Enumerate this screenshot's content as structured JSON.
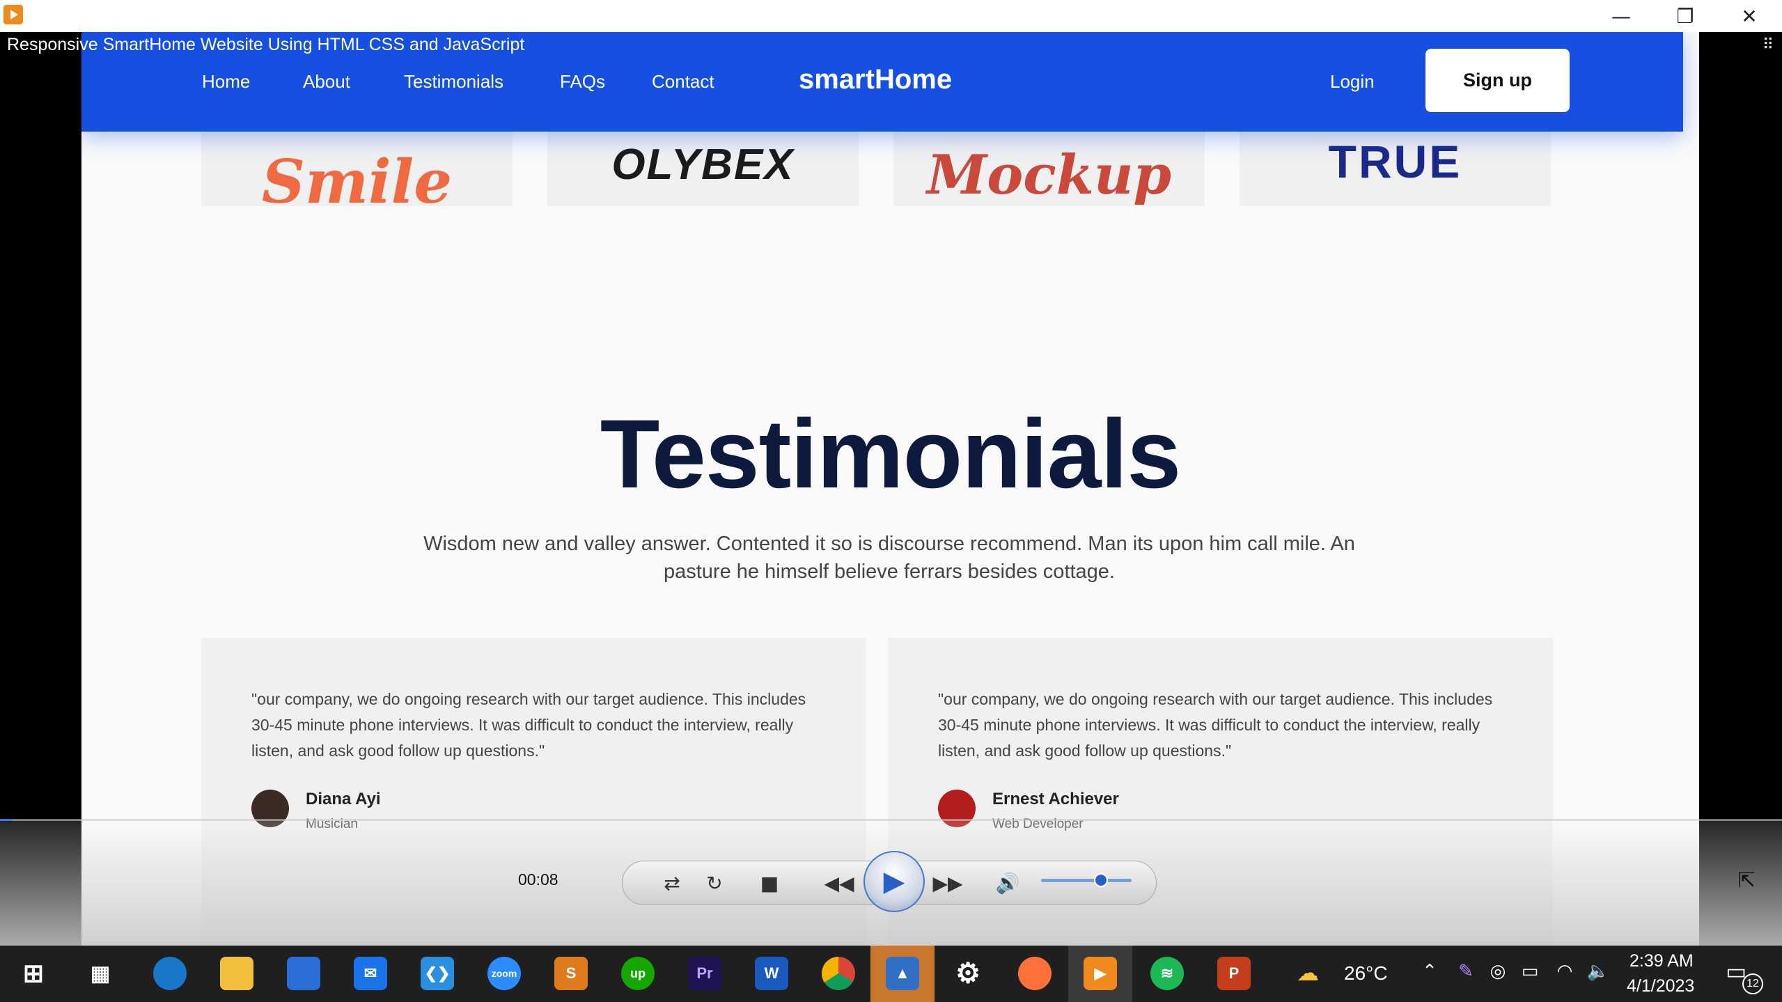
{
  "window": {
    "minimize_glyph": "—",
    "maximize_glyph": "❐",
    "close_glyph": "✕"
  },
  "video": {
    "title": "Responsive SmartHome Website Using HTML CSS and JavaScript"
  },
  "site": {
    "nav": {
      "links": [
        "Home",
        "About",
        "Testimonials",
        "FAQs",
        "Contact"
      ],
      "brand": "smartHome",
      "login": "Login",
      "signup": "Sign up"
    },
    "logos": [
      "Smile",
      "OLYBEX",
      "Mockup",
      "TRUE"
    ],
    "testimonials": {
      "title": "Testimonials",
      "description": "Wisdom new and valley answer. Contented it so is discourse recommend. Man its upon him call mile. An pasture he himself believe ferrars besides cottage.",
      "cards": [
        {
          "quote": "\"our company, we do ongoing research with our target audience. This includes 30-45 minute phone interviews. It was difficult to conduct the interview, really listen, and ask good follow up questions.\"",
          "name": "Diana Ayi",
          "role": "Musician"
        },
        {
          "quote": "\"our company, we do ongoing research with our target audience. This includes 30-45 minute phone interviews. It was difficult to conduct the interview, really listen, and ask good follow up questions.\"",
          "name": "Ernest Achiever",
          "role": "Web Developer"
        }
      ]
    }
  },
  "player": {
    "time": "00:08",
    "progress_fraction": 0.007,
    "volume_fraction": 0.66,
    "play_glyph": "▶",
    "rewind_glyph": "◀◀",
    "forward_glyph": "▶▶",
    "stop_glyph": "■",
    "repeat_glyph": "↻",
    "ab_glyph": "⇄",
    "volume_glyph": "🔊",
    "fullscreen_glyph": "⇱"
  },
  "taskbar": {
    "apps": [
      "edge-icon",
      "file-explorer-icon",
      "microsoft-store-icon",
      "mail-icon",
      "vscode-icon",
      "zoom-icon",
      "sublime-text-icon",
      "upwork-icon",
      "premiere-pro-icon",
      "word-icon",
      "chrome-icon",
      "photos-icon",
      "settings-icon",
      "firefox-icon",
      "media-player-icon",
      "spotify-icon",
      "powerpoint-icon"
    ],
    "zoom_label": "zoom",
    "upwork_label": "up",
    "premiere_label": "Pr",
    "word_label": "W",
    "powerpoint_label": "P",
    "weather_temp": "26°C",
    "time": "2:39 AM",
    "date": "4/1/2023",
    "notifications": "12"
  },
  "colors": {
    "brand_blue": "#1550e0",
    "heading_navy": "#0d1a3d",
    "taskbar": "#1f1f1f",
    "player_orange": "#f08a1c"
  }
}
